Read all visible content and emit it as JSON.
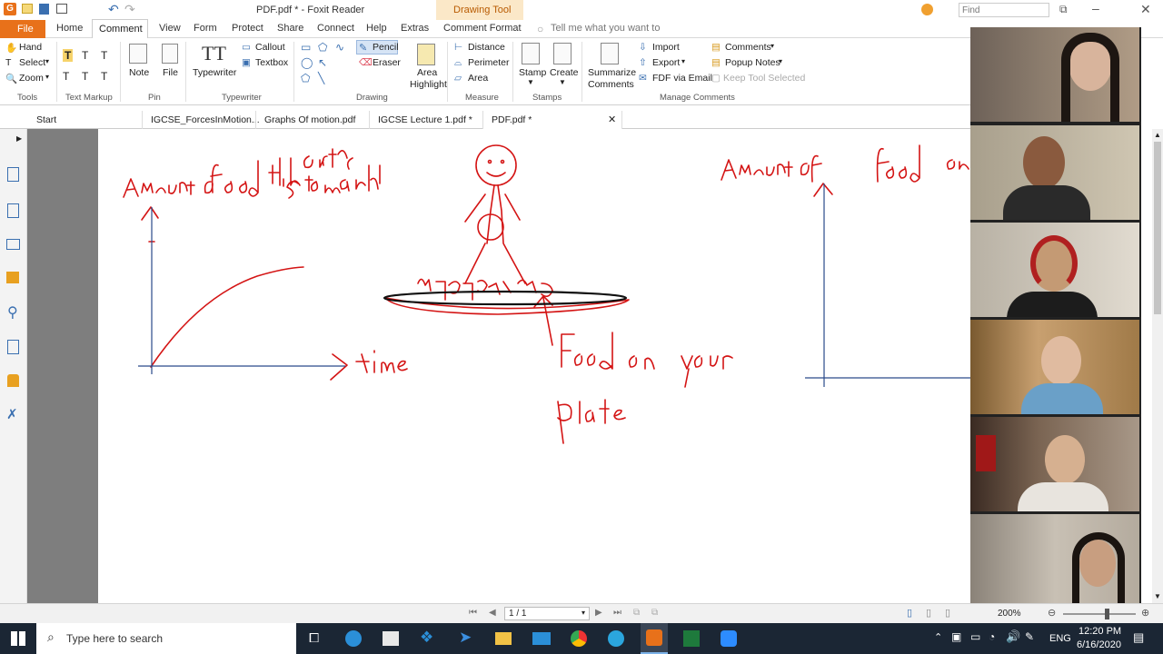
{
  "window": {
    "title": "PDF.pdf * - Foxit Reader",
    "context_tab": "Drawing Tool",
    "search_placeholder": "Find"
  },
  "menu": {
    "file": "File",
    "items": [
      "Home",
      "Comment",
      "View",
      "Form",
      "Protect",
      "Share",
      "Connect",
      "Help",
      "Extras",
      "Comment Format"
    ],
    "active": "Comment",
    "tell_me": "Tell me what you want to"
  },
  "ribbon": {
    "tools": {
      "hand": "Hand",
      "select": "Select",
      "zoom": "Zoom",
      "label": "Tools"
    },
    "text_markup": {
      "label": "Text Markup"
    },
    "pin": {
      "note": "Note",
      "file": "File",
      "label": "Pin"
    },
    "typewriter": {
      "typewriter": "Typewriter",
      "callout": "Callout",
      "textbox": "Textbox",
      "label": "Typewriter"
    },
    "drawing": {
      "pencil": "Pencil",
      "eraser": "Eraser",
      "area_highlight_1": "Area",
      "area_highlight_2": "Highlight",
      "label": "Drawing"
    },
    "measure": {
      "distance": "Distance",
      "perimeter": "Perimeter",
      "area": "Area",
      "label": "Measure"
    },
    "stamps": {
      "stamp": "Stamp",
      "create": "Create",
      "label": "Stamps"
    },
    "manage": {
      "summarize_1": "Summarize",
      "summarize_2": "Comments",
      "import": "Import",
      "export": "Export",
      "fdf": "FDF via Email",
      "comments": "Comments",
      "popup": "Popup Notes",
      "keep_tool": "Keep Tool Selected",
      "label": "Manage Comments"
    }
  },
  "doc_tabs": [
    "Start",
    "IGCSE_ForcesInMotion...",
    "Graphs Of motion.pdf",
    "IGCSE Lecture 1.pdf *",
    "PDF.pdf *"
  ],
  "status": {
    "page": "1 / 1",
    "zoom": "200%"
  },
  "taskbar": {
    "search": "Type here to search",
    "time": "12:20 PM",
    "date": "6/16/2020",
    "lang": "ENG"
  },
  "colors": {
    "ink": "#d41414",
    "axis": "#2a4a8a",
    "ribbon_accent": "#e8711a",
    "taskbar": "#1b2634"
  }
}
